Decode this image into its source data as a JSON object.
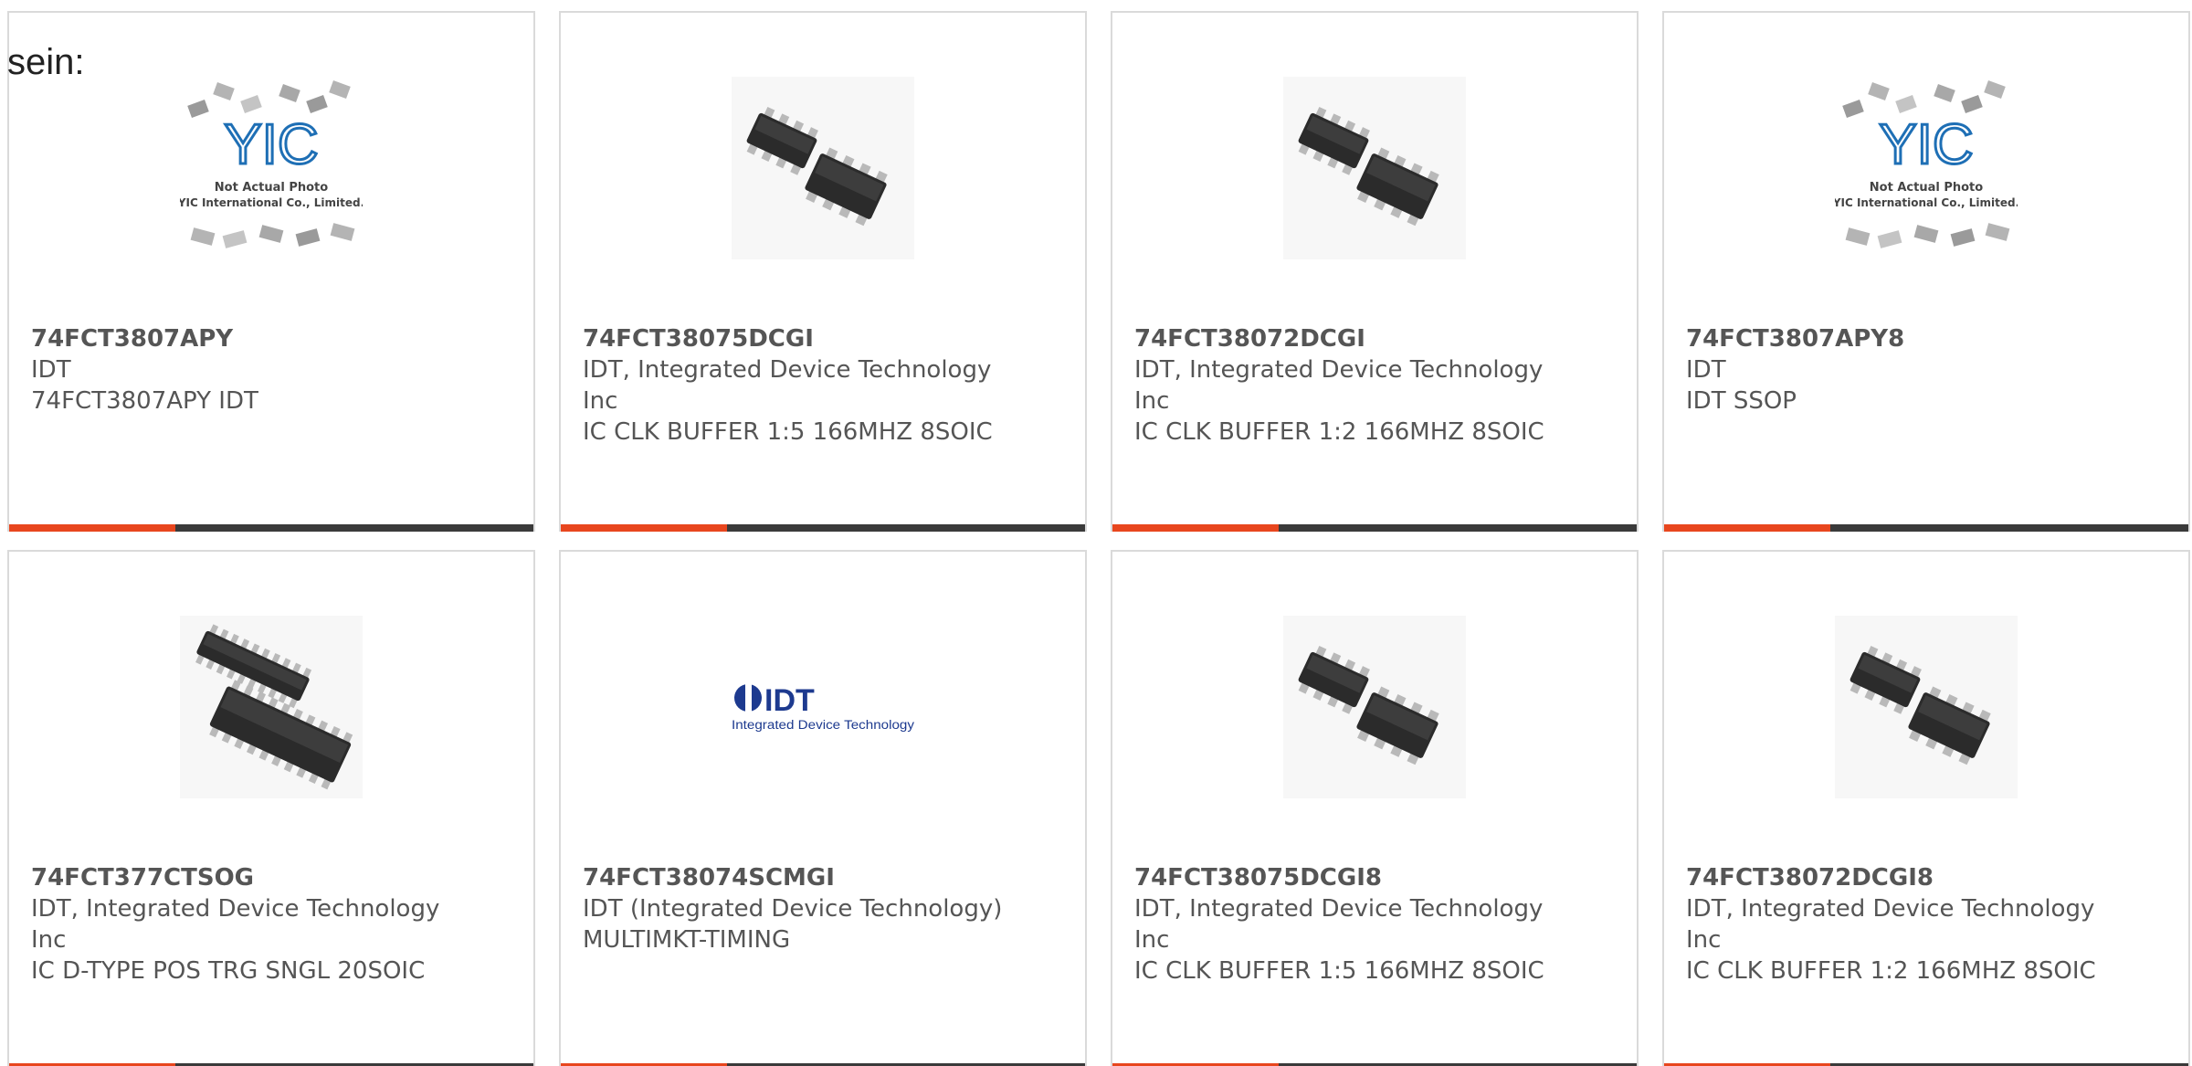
{
  "page": {
    "intro_text": "sein:",
    "accent_color": "#e8461e",
    "bar_color": "#3a3a3a",
    "idt_blue": "#1d3a8f"
  },
  "placeholder": {
    "line1": "Not Actual Photo",
    "line2": "YIC International Co., Limited.",
    "logo_text": "YIC"
  },
  "idt_logo": {
    "wordmark": "IDT",
    "tagline": "Integrated Device Technology"
  },
  "products": [
    {
      "part_no": "74FCT3807APY",
      "maker": "IDT",
      "desc": "74FCT3807APY IDT",
      "image": "placeholder"
    },
    {
      "part_no": "74FCT38075DCGI",
      "maker": "IDT, Integrated Device Technology Inc",
      "desc": "IC CLK BUFFER 1:5 166MHZ 8SOIC",
      "image": "soic8"
    },
    {
      "part_no": "74FCT38072DCGI",
      "maker": "IDT, Integrated Device Technology Inc",
      "desc": "IC CLK BUFFER 1:2 166MHZ 8SOIC",
      "image": "soic8"
    },
    {
      "part_no": "74FCT3807APY8",
      "maker": "IDT",
      "desc": "IDT SSOP",
      "image": "placeholder"
    },
    {
      "part_no": "74FCT377CTSOG",
      "maker": "IDT, Integrated Device Technology Inc",
      "desc": "IC D-TYPE POS TRG SNGL 20SOIC",
      "image": "soic20"
    },
    {
      "part_no": "74FCT38074SCMGI",
      "maker": "IDT (Integrated Device Technology)",
      "desc": "MULTIMKT-TIMING",
      "image": "idt-logo"
    },
    {
      "part_no": "74FCT38075DCGI8",
      "maker": "IDT, Integrated Device Technology Inc",
      "desc": "IC CLK BUFFER 1:5 166MHZ 8SOIC",
      "image": "soic8"
    },
    {
      "part_no": "74FCT38072DCGI8",
      "maker": "IDT, Integrated Device Technology Inc",
      "desc": "IC CLK BUFFER 1:2 166MHZ 8SOIC",
      "image": "soic8"
    }
  ]
}
